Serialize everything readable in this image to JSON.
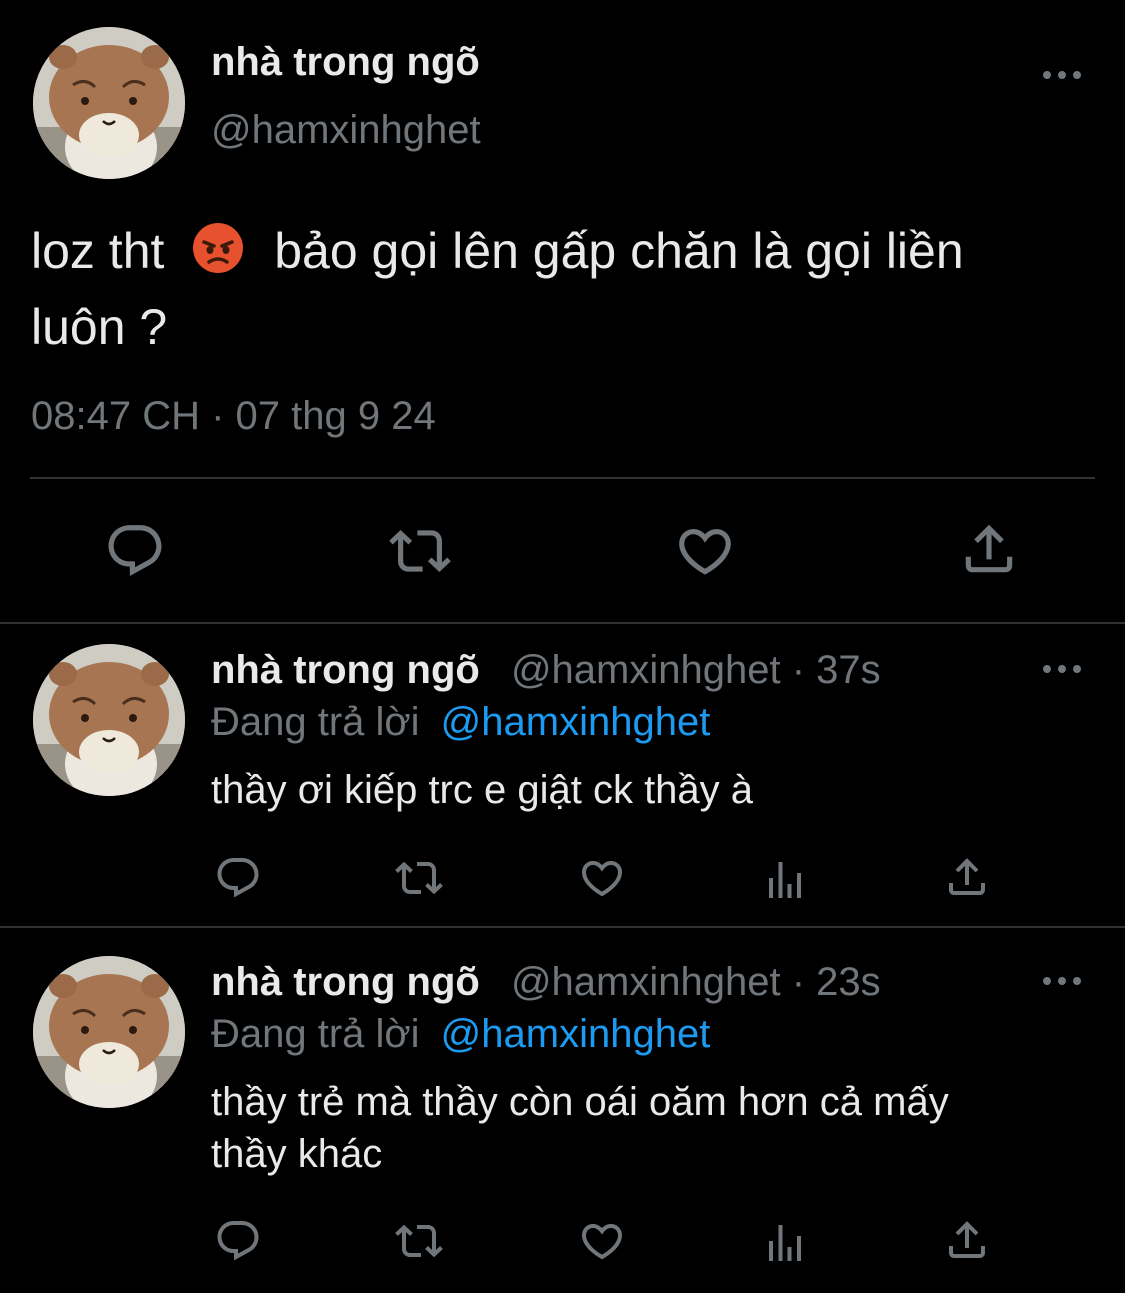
{
  "main_tweet": {
    "display_name": "nhà trong ngõ",
    "handle": "@hamxinhghet",
    "text_before_emoji": "loz tht",
    "emoji": "angry-face",
    "text_after_emoji": "bảo gọi lên gấp chăn là gọi liền",
    "text_line2": "luôn ?",
    "timestamp": "08:47 CH · 07 thg 9 24"
  },
  "replies": [
    {
      "display_name": "nhà trong ngõ",
      "handle": "@hamxinhghet",
      "time": "· 37s",
      "replying_prefix": "Đang trả lời",
      "replying_to": "@hamxinhghet",
      "text_line1": "thầy ơi kiếp trc e giật ck thầy à",
      "text_line2": ""
    },
    {
      "display_name": "nhà trong ngõ",
      "handle": "@hamxinhghet",
      "time": "· 23s",
      "replying_prefix": "Đang trả lời",
      "replying_to": "@hamxinhghet",
      "text_line1": "thầy trẻ mà thầy còn oái oăm hơn cả mấy",
      "text_line2": "thầy khác"
    }
  ],
  "icons": {
    "reply": "reply-icon",
    "retweet": "retweet-icon",
    "like": "heart-icon",
    "views": "views-icon",
    "share": "share-icon",
    "more": "more-icon"
  },
  "colors": {
    "background": "#000000",
    "text": "#e7e9ea",
    "secondary": "#71767b",
    "link": "#1d9bf0",
    "divider": "#2f3336"
  }
}
